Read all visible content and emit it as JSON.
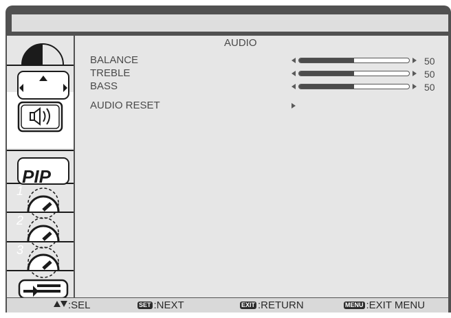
{
  "menu": {
    "title": "AUDIO"
  },
  "rows": [
    {
      "label": "BALANCE",
      "value": "50",
      "level": 0.5
    },
    {
      "label": "TREBLE",
      "value": "50",
      "level": 0.5
    },
    {
      "label": "BASS",
      "value": "50",
      "level": 0.5
    },
    {
      "label": "AUDIO RESET"
    }
  ],
  "sidebar": {
    "items": [
      {
        "icon": "picture-icon",
        "label": ""
      },
      {
        "icon": "screen-icon",
        "label": ""
      },
      {
        "icon": "audio-icon",
        "label": ""
      },
      {
        "icon": "pip-icon",
        "label": "PIP"
      },
      {
        "icon": "config1-icon",
        "label": "1"
      },
      {
        "icon": "config2-icon",
        "label": "2"
      },
      {
        "icon": "config3-icon",
        "label": "3"
      },
      {
        "icon": "input-icon",
        "label": ""
      }
    ]
  },
  "footer": {
    "sel": ":SEL",
    "set_badge": "SET",
    "next": ":NEXT",
    "exit_badge": "EXIT",
    "return": ":RETURN",
    "menu_badge": "MENU",
    "exit_menu": ":EXIT MENU"
  },
  "colors": {
    "frame": "#515151",
    "panel": "#e6e6e6",
    "text": "#4a4a4a"
  }
}
